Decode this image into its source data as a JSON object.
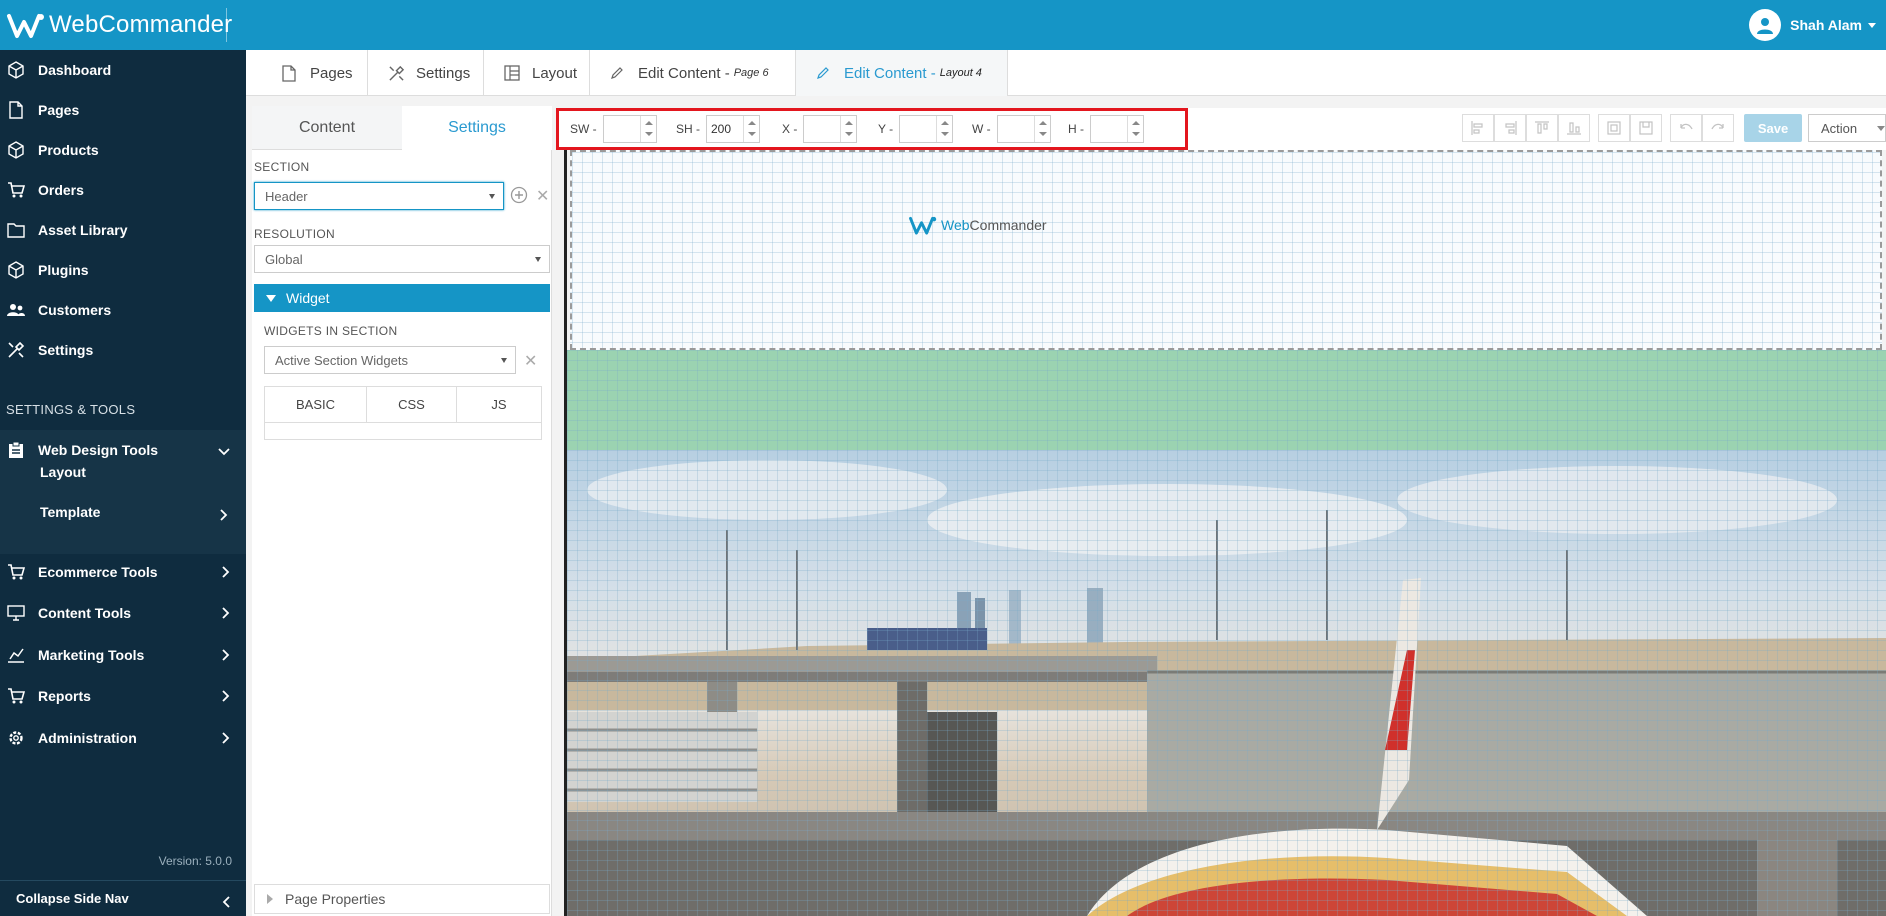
{
  "app": {
    "brand": "WebCommander",
    "user_name": "Shah Alam"
  },
  "sidebar": {
    "items": [
      {
        "label": "Dashboard"
      },
      {
        "label": "Pages"
      },
      {
        "label": "Products"
      },
      {
        "label": "Orders"
      },
      {
        "label": "Asset Library"
      },
      {
        "label": "Plugins"
      },
      {
        "label": "Customers"
      },
      {
        "label": "Settings"
      }
    ],
    "section_title": "SETTINGS & TOOLS",
    "tools": [
      {
        "label": "Web Design Tools"
      },
      {
        "label": "Ecommerce Tools"
      },
      {
        "label": "Content Tools"
      },
      {
        "label": "Marketing Tools"
      },
      {
        "label": "Reports"
      },
      {
        "label": "Administration"
      }
    ],
    "sub_items": [
      {
        "label": "Layout"
      },
      {
        "label": "Template"
      }
    ],
    "version": "Version: 5.0.0",
    "collapse_label": "Collapse Side Nav"
  },
  "tabs": [
    {
      "label": "Pages",
      "suffix": ""
    },
    {
      "label": "Settings",
      "suffix": ""
    },
    {
      "label": "Layout",
      "suffix": ""
    },
    {
      "label": "Edit Content - ",
      "suffix": "Page 6"
    },
    {
      "label": "Edit Content - ",
      "suffix": "Layout 4"
    }
  ],
  "panel": {
    "tab_content": "Content",
    "tab_settings": "Settings",
    "section_label": "SECTION",
    "section_value": "Header",
    "resolution_label": "RESOLUTION",
    "resolution_value": "Global",
    "widget_title": "Widget",
    "widgets_label": "WIDGETS IN SECTION",
    "widgets_value": "Active Section Widgets",
    "wtabs": [
      "BASIC",
      "CSS",
      "JS"
    ],
    "page_properties": "Page Properties"
  },
  "toolbar": {
    "fields": [
      {
        "label": "SW -",
        "value": ""
      },
      {
        "label": "SH -",
        "value": "200"
      },
      {
        "label": "X -",
        "value": ""
      },
      {
        "label": "Y -",
        "value": ""
      },
      {
        "label": "W -",
        "value": ""
      },
      {
        "label": "H -",
        "value": ""
      }
    ],
    "save_label": "Save",
    "action_label": "Action"
  },
  "canvas": {
    "logo_prefix": "Web",
    "logo_suffix": "Commander"
  },
  "colors": {
    "topbar": "#1595c6",
    "sidebar": "#0f2c3f",
    "accent": "#2a9ad0",
    "highlight_box": "#e3161e",
    "green_section": "#9bd3b1"
  }
}
